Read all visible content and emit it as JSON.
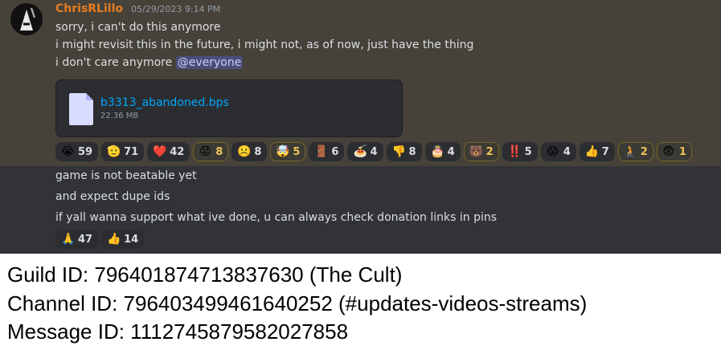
{
  "message": {
    "author": "ChrisRLillo",
    "timestamp": "05/29/2023 9:14 PM",
    "lines": [
      "sorry, i can't do this anymore",
      "i might revisit this in the future, i might not, as of now, just have the thing",
      "i don't care anymore "
    ],
    "mention": "@everyone",
    "attachment": {
      "name": "b3313_abandoned.bps",
      "size": "22.36 MB",
      "icon": "file-icon"
    },
    "reactions": [
      {
        "emoji": "😭",
        "count": "59",
        "me": false
      },
      {
        "emoji": "🫡",
        "count": "71",
        "me": false
      },
      {
        "emoji": "❤️",
        "count": "42",
        "me": false
      },
      {
        "emoji": "😟",
        "count": "8",
        "me": true
      },
      {
        "emoji": "☹️",
        "count": "8",
        "me": false
      },
      {
        "emoji": "🤯",
        "count": "5",
        "me": true
      },
      {
        "emoji": "🚪",
        "count": "6",
        "me": false
      },
      {
        "emoji": "🍝",
        "count": "4",
        "me": false
      },
      {
        "emoji": "👎",
        "count": "8",
        "me": false
      },
      {
        "emoji": "🎂",
        "count": "4",
        "me": false
      },
      {
        "emoji": "🐻",
        "count": "2",
        "me": true
      },
      {
        "emoji": "‼️",
        "count": "5",
        "me": false
      },
      {
        "emoji": "😱",
        "count": "4",
        "me": false
      },
      {
        "emoji": "👍",
        "count": "7",
        "me": false
      },
      {
        "emoji": "🧎",
        "count": "2",
        "me": true
      },
      {
        "emoji": "😨",
        "count": "1",
        "me": true
      }
    ]
  },
  "followups": {
    "lines": [
      "game is not beatable yet",
      "and expect dupe ids",
      "if yall wanna support what ive done, u can always check donation links in pins"
    ],
    "reactions": [
      {
        "emoji": "🙏",
        "count": "47",
        "me": false
      },
      {
        "emoji": "👍",
        "count": "14",
        "me": false
      }
    ]
  },
  "caption": {
    "guild": "Guild ID: 796401874713837630 (The Cult)",
    "channel": "Channel ID: 796403499461640252 (#updates-videos-streams)",
    "message": "Message ID: 1112745879582027858"
  },
  "colors": {
    "username": "#e67e22",
    "link": "#00a8fc",
    "highlight_bg": "#46423a",
    "chat_bg": "#313338"
  }
}
